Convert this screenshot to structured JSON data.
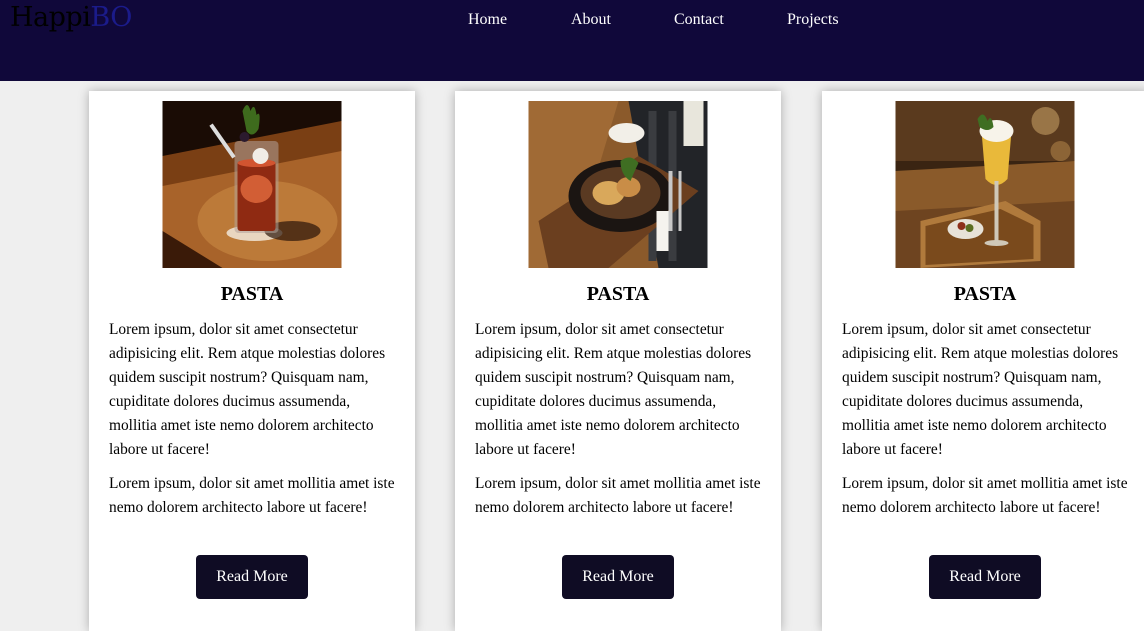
{
  "header": {
    "logo_part1": "Happi",
    "logo_part2": "BO",
    "nav": [
      "Home",
      "About",
      "Contact",
      "Projects"
    ],
    "bg_color": "#10083a"
  },
  "cards": [
    {
      "image": "cocktail-drink-image",
      "title": "PASTA",
      "paragraph1": "Lorem ipsum, dolor sit amet consectetur adipisicing elit. Rem atque molestias dolores quidem suscipit nostrum? Quisquam nam, cupiditate dolores ducimus assumenda, mollitia amet iste nemo dolorem architecto labore ut facere!",
      "paragraph2": "Lorem ipsum, dolor sit amet mollitia amet iste nemo dolorem architecto labore ut facere!",
      "button": "Read More"
    },
    {
      "image": "plated-dish-image",
      "title": "PASTA",
      "paragraph1": "Lorem ipsum, dolor sit amet consectetur adipisicing elit. Rem atque molestias dolores quidem suscipit nostrum? Quisquam nam, cupiditate dolores ducimus assumenda, mollitia amet iste nemo dolorem architecto labore ut facere!",
      "paragraph2": "Lorem ipsum, dolor sit amet mollitia amet iste nemo dolorem architecto labore ut facere!",
      "button": "Read More"
    },
    {
      "image": "champagne-glass-image",
      "title": "PASTA",
      "paragraph1": "Lorem ipsum, dolor sit amet consectetur adipisicing elit. Rem atque molestias dolores quidem suscipit nostrum? Quisquam nam, cupiditate dolores ducimus assumenda, mollitia amet iste nemo dolorem architecto labore ut facere!",
      "paragraph2": "Lorem ipsum, dolor sit amet mollitia amet iste nemo dolorem architecto labore ut facere!",
      "button": "Read More"
    }
  ],
  "colors": {
    "button_bg": "#0f0c24",
    "page_bg": "#efefef"
  }
}
